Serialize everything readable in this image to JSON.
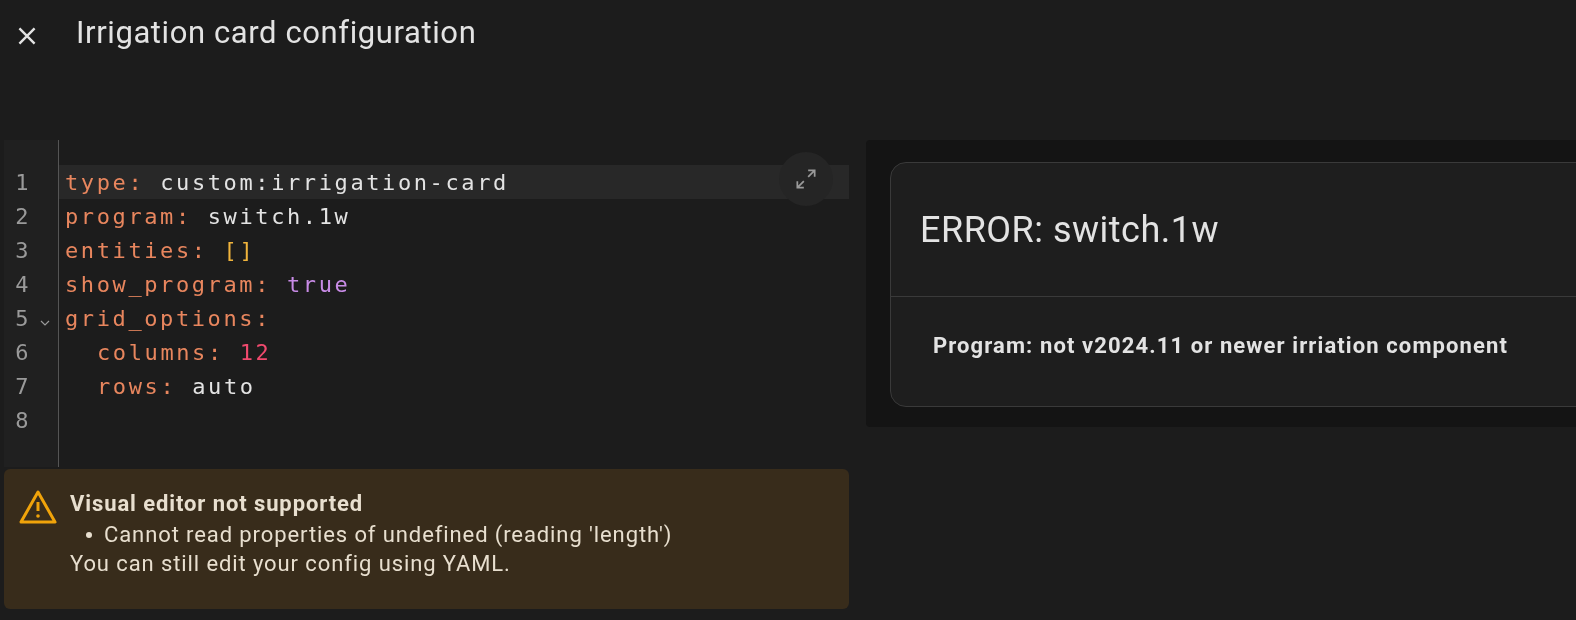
{
  "header": {
    "title": "Irrigation card configuration"
  },
  "editor": {
    "lines": [
      {
        "number": "1",
        "active": true,
        "tokens": [
          {
            "kind": "key",
            "text": "type:"
          },
          {
            "kind": "plain",
            "text": "custom:irrigation-card"
          }
        ]
      },
      {
        "number": "2",
        "active": false,
        "tokens": [
          {
            "kind": "key",
            "text": "program:"
          },
          {
            "kind": "plain",
            "text": "switch.1w"
          }
        ]
      },
      {
        "number": "3",
        "active": false,
        "tokens": [
          {
            "kind": "key",
            "text": "entities:"
          },
          {
            "kind": "bracket",
            "text": "[]"
          }
        ]
      },
      {
        "number": "4",
        "active": false,
        "tokens": [
          {
            "kind": "key",
            "text": "show_program:"
          },
          {
            "kind": "bool",
            "text": "true"
          }
        ]
      },
      {
        "number": "5",
        "active": false,
        "expanded": true,
        "tokens": [
          {
            "kind": "key",
            "text": "grid_options:"
          }
        ],
        "children": [
          {
            "number": "6",
            "active": false,
            "tokens": [
              {
                "kind": "key",
                "text": "columns:"
              },
              {
                "kind": "number",
                "text": "12"
              }
            ]
          },
          {
            "number": "7",
            "active": false,
            "tokens": [
              {
                "kind": "key",
                "text": "rows:"
              },
              {
                "kind": "plain",
                "text": "auto"
              }
            ]
          }
        ]
      },
      {
        "number": "8",
        "active": false
      }
    ]
  },
  "warning": {
    "title": "Visual editor not supported",
    "items": [
      "Cannot read properties of undefined (reading 'length')"
    ],
    "note": "You can still edit your config using YAML."
  },
  "preview": {
    "card_title": "ERROR: switch.1w",
    "message": "Program: not v2024.11 or newer irriation component"
  }
}
